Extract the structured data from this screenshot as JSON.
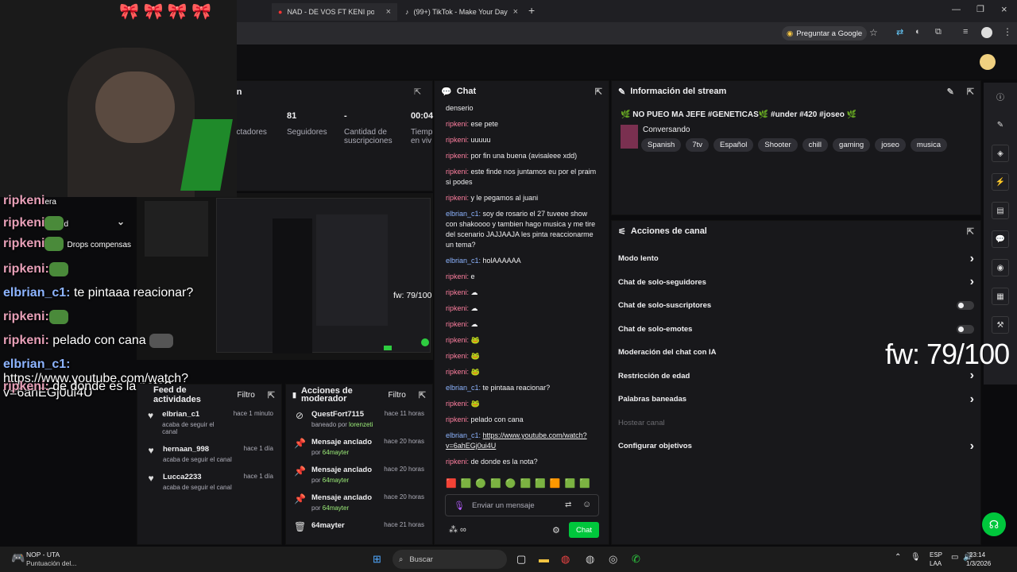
{
  "tabs": [
    {
      "title": "NAD - DE VOS FT KENI por maj"
    },
    {
      "title": "(99+) TikTok - Make Your Day"
    }
  ],
  "browser": {
    "ask_google": "Preguntar a Google"
  },
  "stats": {
    "panel_suffix": "on",
    "followers_value": "81",
    "followers_label": "Seguidores",
    "spectators_label": "ectadores",
    "subs_value": "-",
    "subs_label": "Cantidad de suscripciones",
    "time_value": "00:04",
    "time_label": "Tiemp en viv"
  },
  "overlay": [
    {
      "user": "ripkeni",
      "text": "",
      "type": "r",
      "extra": "era"
    },
    {
      "user": "ripkeni",
      "text": "",
      "type": "r",
      "extra": "d"
    },
    {
      "user": "ripkeni",
      "text": "",
      "type": "r",
      "extra": "Drops compensas"
    },
    {
      "user": "ripkeni:",
      "text": "",
      "type": "r",
      "extra": ""
    },
    {
      "user": "elbrian_c1:",
      "text": "te pintaaa reacionar?",
      "type": "b"
    },
    {
      "user": "ripkeni:",
      "text": "",
      "type": "r"
    },
    {
      "user": "ripkeni:",
      "text": "pelado con cana",
      "type": "r"
    },
    {
      "user": "elbrian_c1:",
      "text": "https://www.youtube.com/watch?v=6ahEGj0ui4U",
      "type": "b"
    },
    {
      "user": "ripkeni:",
      "text": "de donde es la nota?",
      "type": "r"
    }
  ],
  "preview": {
    "fw": "fw: 79/100"
  },
  "fw_big": "fw: 79/100",
  "chat": {
    "title": "Chat",
    "messages": [
      {
        "user": "",
        "text": "denserio",
        "c": "u1"
      },
      {
        "user": "ripkeni:",
        "text": "ese pete",
        "c": "u1"
      },
      {
        "user": "ripkeni:",
        "text": "uuuuu",
        "c": "u1"
      },
      {
        "user": "ripkeni:",
        "text": "por fin una buena (avisaleee xdd)",
        "c": "u1"
      },
      {
        "user": "ripkeni:",
        "text": "este finde nos juntamos eu por el praim si podes",
        "c": "u1"
      },
      {
        "user": "ripkeni:",
        "text": "y le pegamos al juani",
        "c": "u1"
      },
      {
        "user": "elbrian_c1:",
        "text": "soy de rosario el 27 tuveee show con shakoooo y tambien hago musica y me tire del scenario JAJJAAJA les pinta reaccionarme un tema?",
        "c": "u2"
      },
      {
        "user": "elbrian_c1:",
        "text": "holAAAAAA",
        "c": "u2"
      },
      {
        "user": "ripkeni:",
        "text": "e",
        "c": "u1"
      },
      {
        "user": "ripkeni:",
        "text": "☁",
        "c": "u1"
      },
      {
        "user": "ripkeni:",
        "text": "☁",
        "c": "u1"
      },
      {
        "user": "ripkeni:",
        "text": "☁",
        "c": "u1"
      },
      {
        "user": "ripkeni:",
        "text": "🐸",
        "c": "u1"
      },
      {
        "user": "ripkeni:",
        "text": "🐸",
        "c": "u1"
      },
      {
        "user": "ripkeni:",
        "text": "🐸",
        "c": "u1"
      },
      {
        "user": "elbrian_c1:",
        "text": "te pintaaa reacionar?",
        "c": "u2"
      },
      {
        "user": "ripkeni:",
        "text": "🐸",
        "c": "u1"
      },
      {
        "user": "ripkeni:",
        "text": "pelado con cana",
        "c": "u1"
      },
      {
        "user": "elbrian_c1:",
        "text": "https://www.youtube.com/watch?v=6ahEGj0ui4U",
        "c": "u2",
        "link": true
      },
      {
        "user": "ripkeni:",
        "text": "de donde es la nota?",
        "c": "u1"
      }
    ],
    "placeholder": "Enviar un mensaje",
    "send": "Chat"
  },
  "activity": {
    "title": "Feed de actividades",
    "filter": "Filtro",
    "items": [
      {
        "name": "elbrian_c1",
        "sub": "acaba de seguir el canal",
        "time": "hace 1 minuto"
      },
      {
        "name": "hernaan_998",
        "sub": "acaba de seguir el canal",
        "time": "hace 1 día"
      },
      {
        "name": "Lucca2233",
        "sub": "acaba de seguir el canal",
        "time": "hace 1 día"
      }
    ]
  },
  "modactions": {
    "title": "Acciones de moderador",
    "filter": "Filtro",
    "items": [
      {
        "name": "QuestFort7115",
        "pre": "baneado por ",
        "by": "lorenzeti",
        "time": "hace 11 horas",
        "icon": "⊘"
      },
      {
        "name": "Mensaje anclado",
        "pre": "por ",
        "by": "64mayter",
        "time": "hace 20 horas",
        "icon": "📌"
      },
      {
        "name": "Mensaje anclado",
        "pre": "por ",
        "by": "64mayter",
        "time": "hace 20 horas",
        "icon": "📌"
      },
      {
        "name": "Mensaje anclado",
        "pre": "por ",
        "by": "64mayter",
        "time": "hace 20 horas",
        "icon": "📌"
      },
      {
        "name": "64mayter",
        "pre": "",
        "by": "",
        "time": "hace 21 horas",
        "icon": "🗑"
      }
    ]
  },
  "stream": {
    "title": "Información del stream",
    "stream_title": "🌿 NO PUEO MA JEFE #GENETICAS🌿 #under #420 #joseo 🌿",
    "category": "Conversando",
    "tags": [
      "Spanish",
      "7tv",
      "Español",
      "Shooter",
      "chill",
      "gaming",
      "joseo",
      "musica"
    ]
  },
  "channel": {
    "title": "Acciones de canal",
    "items": [
      {
        "label": "Modo lento",
        "ctrl": "arrow"
      },
      {
        "label": "Chat de solo-seguidores",
        "ctrl": "arrow"
      },
      {
        "label": "Chat de solo-suscriptores",
        "ctrl": "toggle"
      },
      {
        "label": "Chat de solo-emotes",
        "ctrl": "toggle"
      },
      {
        "label": "Moderación del chat con IA",
        "ctrl": "none"
      },
      {
        "label": "Restricción de edad",
        "ctrl": "arrow"
      },
      {
        "label": "Palabras baneadas",
        "ctrl": "arrow"
      },
      {
        "label": "Hostear canal",
        "ctrl": "disabled"
      },
      {
        "label": "Configurar objetivos",
        "ctrl": "arrow"
      }
    ]
  },
  "taskbar": {
    "app_name": "NOP - UTA",
    "app_sub": "Puntuación del...",
    "search": "Buscar",
    "lang1": "ESP",
    "lang2": "LAA",
    "time": "23:14",
    "date": "1/3/2026"
  },
  "colors": {
    "accent": "#00c73c",
    "twitch_green": "#9ef07a"
  }
}
